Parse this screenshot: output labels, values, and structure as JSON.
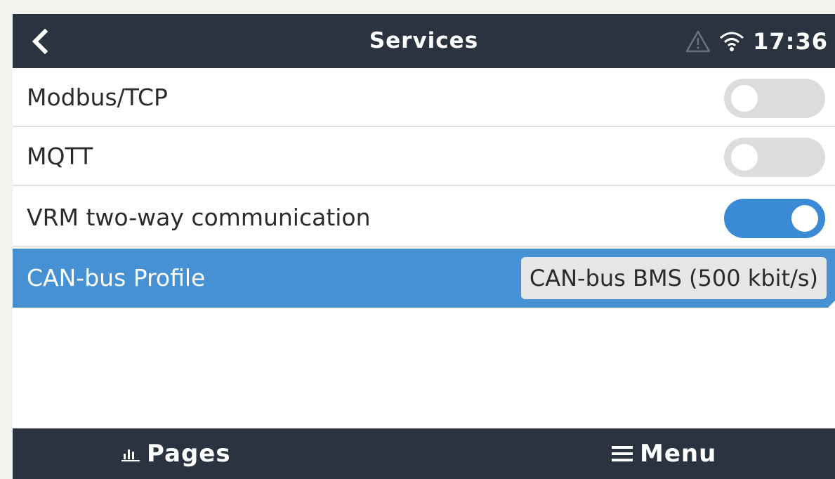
{
  "header": {
    "title": "Services",
    "time": "17:36",
    "icons": {
      "back": "chevron-left-icon",
      "alert": "warning-icon",
      "wifi": "wifi-icon"
    }
  },
  "settings": [
    {
      "label": "Modbus/TCP",
      "control": "toggle",
      "enabled": false
    },
    {
      "label": "MQTT",
      "control": "toggle",
      "enabled": false
    },
    {
      "label": "VRM two-way communication",
      "control": "toggle",
      "enabled": true
    },
    {
      "label": "CAN-bus Profile",
      "control": "select",
      "value": "CAN-bus BMS (500 kbit/s)",
      "selected": true
    }
  ],
  "footer": {
    "pages_label": "Pages",
    "menu_label": "Menu",
    "icons": {
      "pages": "bar-chart-icon",
      "menu": "hamburger-menu-icon"
    }
  },
  "colors": {
    "header_bg": "#2c3340",
    "accent": "#3a8ad6",
    "selected_row": "#4591d4",
    "toggle_off": "#dcdcdc"
  }
}
